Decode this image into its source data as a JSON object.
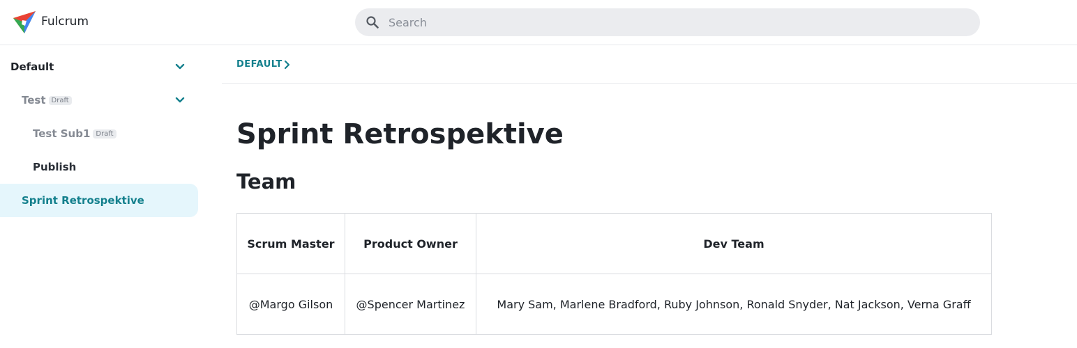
{
  "app": {
    "name": "Fulcrum"
  },
  "search": {
    "placeholder": "Search",
    "value": ""
  },
  "sidebar": {
    "items": [
      {
        "label": "Default",
        "badge": "",
        "expanded": true
      },
      {
        "label": "Test",
        "badge": "Draft",
        "expanded": true
      },
      {
        "label": "Test Sub1",
        "badge": "Draft"
      },
      {
        "label": "Publish",
        "badge": ""
      },
      {
        "label": "Sprint Retrospektive",
        "badge": "",
        "active": true
      }
    ]
  },
  "breadcrumb": {
    "items": [
      "DEFAULT"
    ]
  },
  "page": {
    "title": "Sprint Retrospektive",
    "section_title": "Team",
    "table": {
      "headers": [
        "Scrum Master",
        "Product Owner",
        "Dev Team"
      ],
      "rows": [
        [
          "@Margo Gilson",
          "@Spencer Martinez",
          "Mary Sam, Marlene Bradford, Ruby Johnson, Ronald Snyder, Nat Jackson, Verna Graff"
        ]
      ]
    }
  },
  "colors": {
    "accent": "#14808d",
    "active_bg": "#e5f6fc",
    "search_bg": "#ebecef",
    "muted_text": "#8a8f98"
  },
  "icons": {
    "logo": "fulcrum-logo-icon",
    "search": "search-icon",
    "expand": "chevron-down-icon",
    "breadcrumb_separator": "chevron-right-icon"
  }
}
